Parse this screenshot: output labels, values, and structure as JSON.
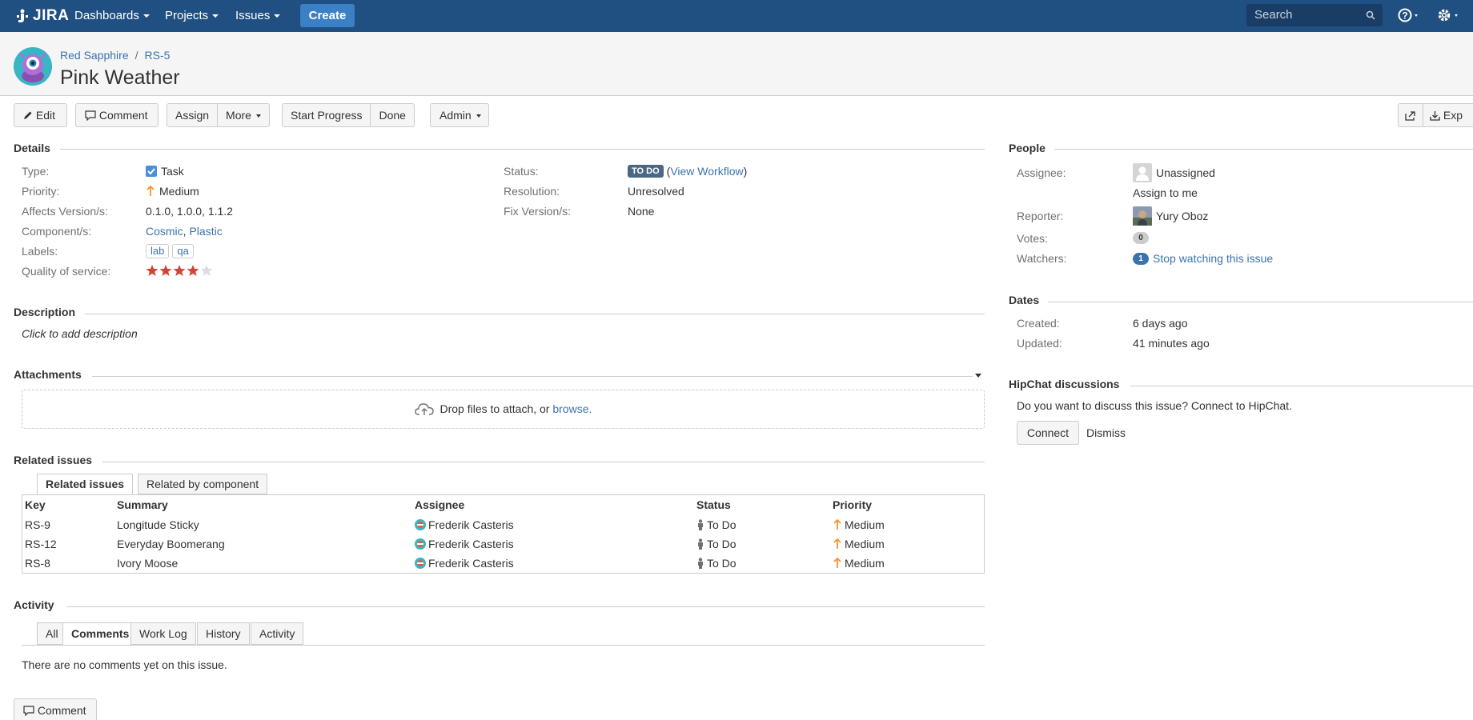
{
  "nav": {
    "logo": "JIRA",
    "dashboards": "Dashboards",
    "projects": "Projects",
    "issues": "Issues",
    "create": "Create",
    "search_placeholder": "Search"
  },
  "header": {
    "project": "Red Sapphire",
    "issue_key": "RS-5",
    "title": "Pink Weather"
  },
  "toolbar": {
    "edit": "Edit",
    "comment": "Comment",
    "assign": "Assign",
    "more": "More",
    "start_progress": "Start Progress",
    "done": "Done",
    "admin": "Admin",
    "export": "Exp"
  },
  "details": {
    "heading": "Details",
    "type_label": "Type:",
    "type_value": "Task",
    "priority_label": "Priority:",
    "priority_value": "Medium",
    "affects_label": "Affects Version/s:",
    "affects_value": "0.1.0, 1.0.0, 1.1.2",
    "components_label": "Component/s:",
    "component_1": "Cosmic",
    "component_sep": ", ",
    "component_2": "Plastic",
    "labels_label": "Labels:",
    "label_1": "lab",
    "label_2": "qa",
    "qos_label": "Quality of service:",
    "qos_rating": 4,
    "qos_max": 5,
    "status_label": "Status:",
    "status_value": "TO DO",
    "view_workflow": "View Workflow",
    "resolution_label": "Resolution:",
    "resolution_value": "Unresolved",
    "fix_label": "Fix Version/s:",
    "fix_value": "None"
  },
  "description": {
    "heading": "Description",
    "placeholder": "Click to add description"
  },
  "attachments": {
    "heading": "Attachments",
    "drop_text": "Drop files to attach, or ",
    "browse": "browse."
  },
  "related": {
    "heading": "Related issues",
    "tab_related": "Related issues",
    "tab_component": "Related by component",
    "columns": [
      "Key",
      "Summary",
      "Assignee",
      "Status",
      "Priority"
    ],
    "rows": [
      {
        "key": "RS-9",
        "summary": "Longitude Sticky",
        "assignee": "Frederik Casteris",
        "status": "To Do",
        "priority": "Medium"
      },
      {
        "key": "RS-12",
        "summary": "Everyday Boomerang",
        "assignee": "Frederik Casteris",
        "status": "To Do",
        "priority": "Medium"
      },
      {
        "key": "RS-8",
        "summary": "Ivory Moose",
        "assignee": "Frederik Casteris",
        "status": "To Do",
        "priority": "Medium"
      }
    ]
  },
  "activity": {
    "heading": "Activity",
    "tabs": [
      "All",
      "Comments",
      "Work Log",
      "History",
      "Activity"
    ],
    "active_tab": "Comments",
    "empty": "There are no comments yet on this issue.",
    "comment_button": "Comment"
  },
  "people": {
    "heading": "People",
    "assignee_label": "Assignee:",
    "assignee_value": "Unassigned",
    "assign_to_me": "Assign to me",
    "reporter_label": "Reporter:",
    "reporter_value": "Yury Oboz",
    "votes_label": "Votes:",
    "votes_count": "0",
    "watchers_label": "Watchers:",
    "watchers_count": "1",
    "stop_watching": "Stop watching this issue"
  },
  "dates": {
    "heading": "Dates",
    "created_label": "Created:",
    "created_value": "6 days ago",
    "updated_label": "Updated:",
    "updated_value": "41 minutes ago"
  },
  "hipchat": {
    "heading": "HipChat discussions",
    "prompt": "Do you want to discuss this issue? Connect to HipChat.",
    "connect": "Connect",
    "dismiss": "Dismiss"
  },
  "colors": {
    "nav_bg": "#205081",
    "link": "#3b73af",
    "priority_arrow": "#f79232",
    "star_on": "#d04437",
    "lozenge": "#4a6785"
  }
}
